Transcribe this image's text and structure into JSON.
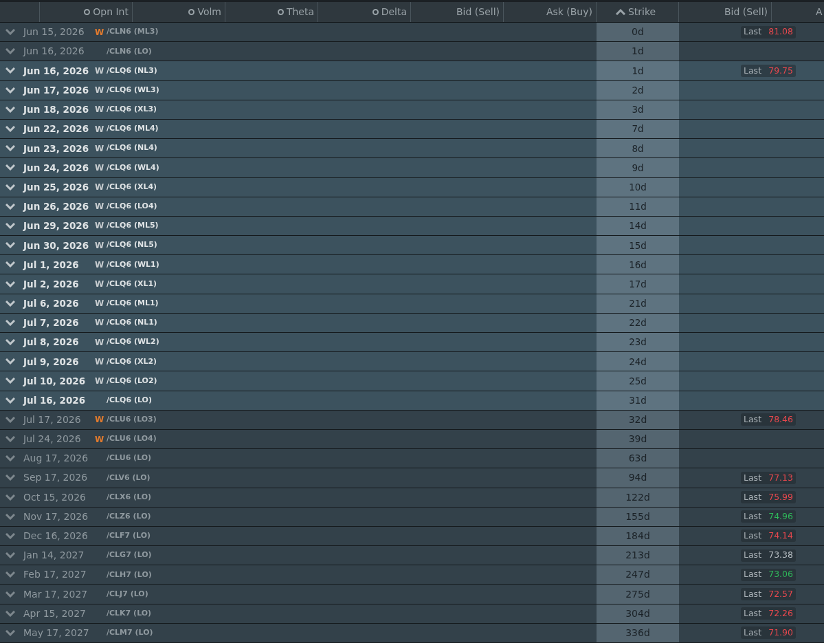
{
  "header": {
    "columns": [
      {
        "label": "Opn Int",
        "kind": "stat"
      },
      {
        "label": "Volm",
        "kind": "stat"
      },
      {
        "label": "Theta",
        "kind": "stat"
      },
      {
        "label": "Delta",
        "kind": "stat"
      },
      {
        "label": "Bid (Sell)",
        "kind": "plain"
      },
      {
        "label": "Ask (Buy)",
        "kind": "plain"
      },
      {
        "label": "Strike",
        "kind": "sorted"
      },
      {
        "label": "Bid (Sell)",
        "kind": "plain"
      },
      {
        "label": "A",
        "kind": "plain"
      }
    ]
  },
  "rows": [
    {
      "date": "Jun 15, 2026",
      "weekly": "W",
      "symbol": "/CLN6 (ML3)",
      "days": "0d",
      "highlighted": false,
      "last_label": "Last",
      "last": "81.08",
      "color": "#e8484e"
    },
    {
      "date": "Jun 16, 2026",
      "symbol": "/CLN6 (LO)",
      "days": "1d",
      "highlighted": false
    },
    {
      "date": "Jun 16, 2026",
      "weekly": "W",
      "symbol": "/CLQ6 (NL3)",
      "days": "1d",
      "highlighted": true,
      "last_label": "Last",
      "last": "79.75",
      "color": "#e8484e"
    },
    {
      "date": "Jun 17, 2026",
      "weekly": "W",
      "symbol": "/CLQ6 (WL3)",
      "days": "2d",
      "highlighted": true
    },
    {
      "date": "Jun 18, 2026",
      "weekly": "W",
      "symbol": "/CLQ6 (XL3)",
      "days": "3d",
      "highlighted": true
    },
    {
      "date": "Jun 22, 2026",
      "weekly": "W",
      "symbol": "/CLQ6 (ML4)",
      "days": "7d",
      "highlighted": true
    },
    {
      "date": "Jun 23, 2026",
      "weekly": "W",
      "symbol": "/CLQ6 (NL4)",
      "days": "8d",
      "highlighted": true
    },
    {
      "date": "Jun 24, 2026",
      "weekly": "W",
      "symbol": "/CLQ6 (WL4)",
      "days": "9d",
      "highlighted": true
    },
    {
      "date": "Jun 25, 2026",
      "weekly": "W",
      "symbol": "/CLQ6 (XL4)",
      "days": "10d",
      "highlighted": true
    },
    {
      "date": "Jun 26, 2026",
      "weekly": "W",
      "symbol": "/CLQ6 (LO4)",
      "days": "11d",
      "highlighted": true
    },
    {
      "date": "Jun 29, 2026",
      "weekly": "W",
      "symbol": "/CLQ6 (ML5)",
      "days": "14d",
      "highlighted": true
    },
    {
      "date": "Jun 30, 2026",
      "weekly": "W",
      "symbol": "/CLQ6 (NL5)",
      "days": "15d",
      "highlighted": true
    },
    {
      "date": "Jul 1, 2026",
      "weekly": "W",
      "symbol": "/CLQ6 (WL1)",
      "days": "16d",
      "highlighted": true
    },
    {
      "date": "Jul 2, 2026",
      "weekly": "W",
      "symbol": "/CLQ6 (XL1)",
      "days": "17d",
      "highlighted": true
    },
    {
      "date": "Jul 6, 2026",
      "weekly": "W",
      "symbol": "/CLQ6 (ML1)",
      "days": "21d",
      "highlighted": true
    },
    {
      "date": "Jul 7, 2026",
      "weekly": "W",
      "symbol": "/CLQ6 (NL1)",
      "days": "22d",
      "highlighted": true
    },
    {
      "date": "Jul 8, 2026",
      "weekly": "W",
      "symbol": "/CLQ6 (WL2)",
      "days": "23d",
      "highlighted": true
    },
    {
      "date": "Jul 9, 2026",
      "weekly": "W",
      "symbol": "/CLQ6 (XL2)",
      "days": "24d",
      "highlighted": true
    },
    {
      "date": "Jul 10, 2026",
      "weekly": "W",
      "symbol": "/CLQ6 (LO2)",
      "days": "25d",
      "highlighted": true
    },
    {
      "date": "Jul 16, 2026",
      "symbol": "/CLQ6 (LO)",
      "days": "31d",
      "highlighted": true
    },
    {
      "date": "Jul 17, 2026",
      "weekly": "W",
      "symbol": "/CLU6 (LO3)",
      "days": "32d",
      "highlighted": false,
      "last_label": "Last",
      "last": "78.46",
      "color": "#e8484e"
    },
    {
      "date": "Jul 24, 2026",
      "weekly": "W",
      "symbol": "/CLU6 (LO4)",
      "days": "39d",
      "highlighted": false
    },
    {
      "date": "Aug 17, 2026",
      "symbol": "/CLU6 (LO)",
      "days": "63d",
      "highlighted": false
    },
    {
      "date": "Sep 17, 2026",
      "symbol": "/CLV6 (LO)",
      "days": "94d",
      "highlighted": false,
      "last_label": "Last",
      "last": "77.13",
      "color": "#e8484e"
    },
    {
      "date": "Oct 15, 2026",
      "symbol": "/CLX6 (LO)",
      "days": "122d",
      "highlighted": false,
      "last_label": "Last",
      "last": "75.99",
      "color": "#e8484e"
    },
    {
      "date": "Nov 17, 2026",
      "symbol": "/CLZ6 (LO)",
      "days": "155d",
      "highlighted": false,
      "last_label": "Last",
      "last": "74.96",
      "color": "#2fb85a"
    },
    {
      "date": "Dec 16, 2026",
      "symbol": "/CLF7 (LO)",
      "days": "184d",
      "highlighted": false,
      "last_label": "Last",
      "last": "74.14",
      "color": "#e8484e"
    },
    {
      "date": "Jan 14, 2027",
      "symbol": "/CLG7 (LO)",
      "days": "213d",
      "highlighted": false,
      "last_label": "Last",
      "last": "73.38",
      "color": "#b8bfc4"
    },
    {
      "date": "Feb 17, 2027",
      "symbol": "/CLH7 (LO)",
      "days": "247d",
      "highlighted": false,
      "last_label": "Last",
      "last": "73.06",
      "color": "#2fb85a"
    },
    {
      "date": "Mar 17, 2027",
      "symbol": "/CLJ7 (LO)",
      "days": "275d",
      "highlighted": false,
      "last_label": "Last",
      "last": "72.57",
      "color": "#e8484e"
    },
    {
      "date": "Apr 15, 2027",
      "symbol": "/CLK7 (LO)",
      "days": "304d",
      "highlighted": false,
      "last_label": "Last",
      "last": "72.26",
      "color": "#e8484e"
    },
    {
      "date": "May 17, 2027",
      "symbol": "/CLM7 (LO)",
      "days": "336d",
      "highlighted": false,
      "last_label": "Last",
      "last": "71.90",
      "color": "#e8484e"
    }
  ]
}
